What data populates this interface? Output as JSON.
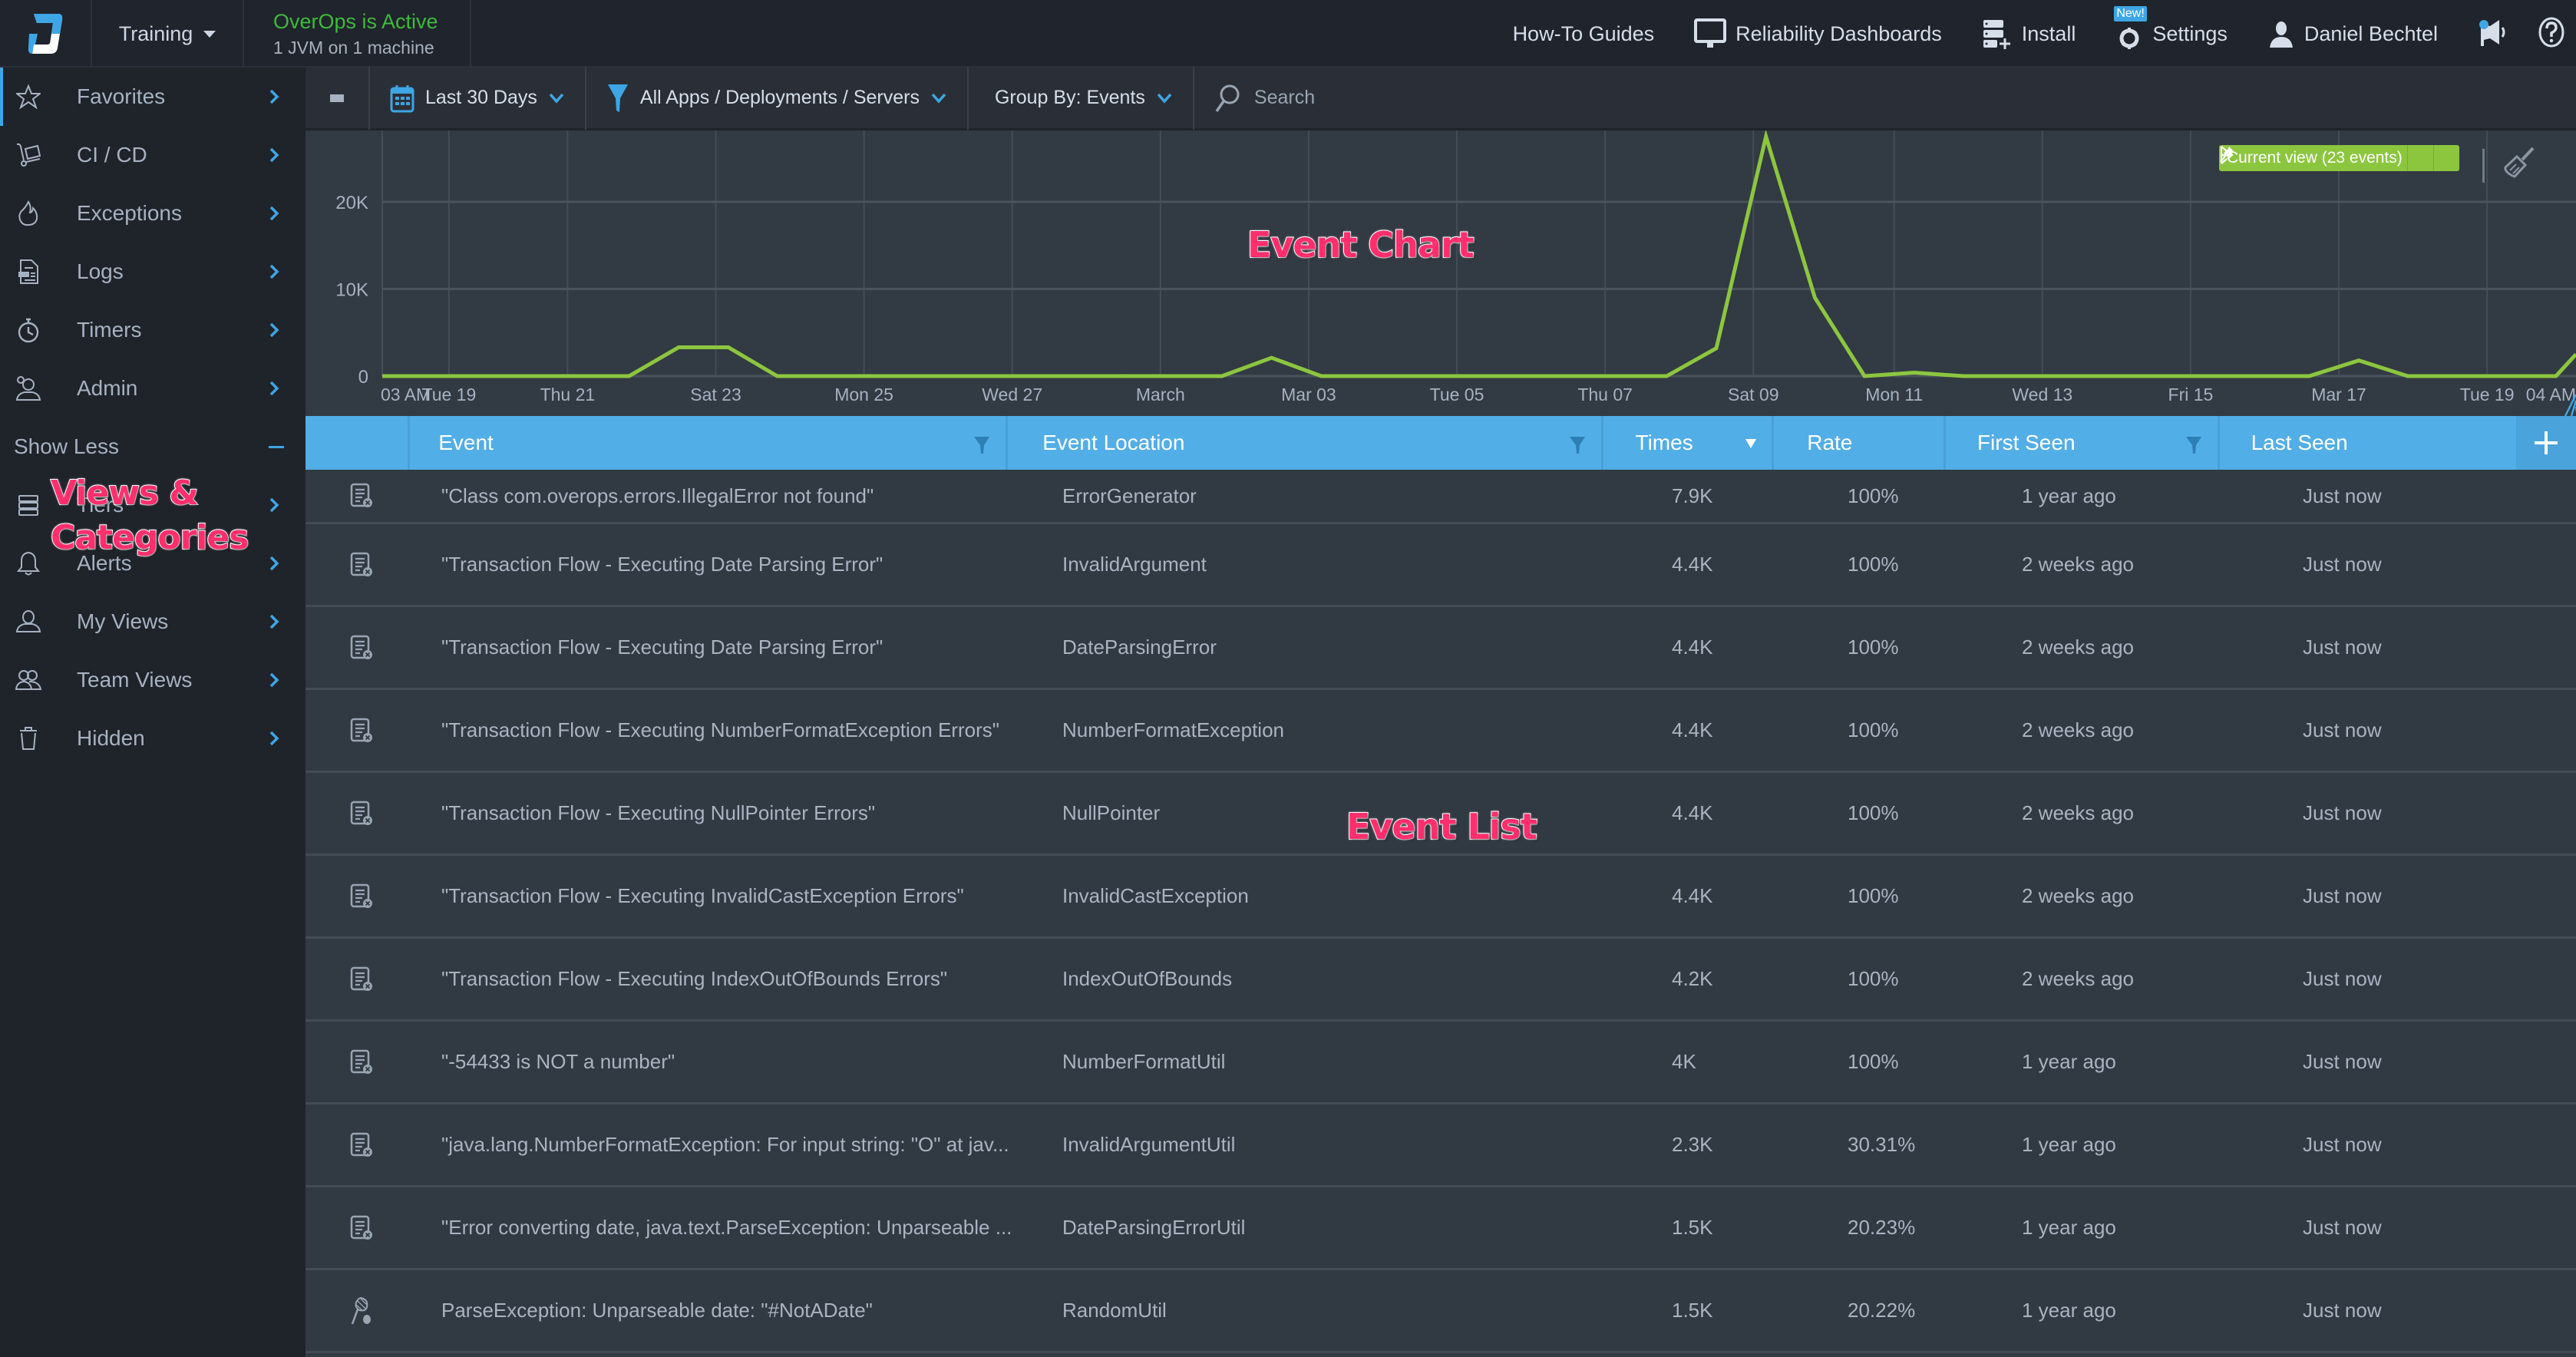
{
  "topbar": {
    "logo_icon": "overops-logo",
    "environment": "Training",
    "status_title": "OverOps is Active",
    "status_subtitle": "1 JVM on 1 machine",
    "nav": [
      {
        "label": "How-To Guides",
        "icon": null
      },
      {
        "label": "Reliability Dashboards",
        "icon": "monitor-icon"
      },
      {
        "label": "Install",
        "icon": "server-plus-icon"
      },
      {
        "label": "Settings",
        "icon": "gear-icon",
        "badge": "New!"
      },
      {
        "label": "Daniel Bechtel",
        "icon": "user-icon"
      }
    ],
    "announce_icon": "megaphone-icon",
    "help_icon": "help-icon"
  },
  "sidebar": {
    "items": [
      {
        "label": "Favorites",
        "icon": "star-icon",
        "active": true
      },
      {
        "label": "CI / CD",
        "icon": "dolly-icon"
      },
      {
        "label": "Exceptions",
        "icon": "flame-icon"
      },
      {
        "label": "Logs",
        "icon": "log-file-icon"
      },
      {
        "label": "Timers",
        "icon": "stopwatch-icon"
      },
      {
        "label": "Admin",
        "icon": "admin-user-icon"
      }
    ],
    "show_less": "Show Less",
    "more_items": [
      {
        "label": "Tiers",
        "icon": "tiers-icon"
      },
      {
        "label": "Alerts",
        "icon": "bell-icon"
      },
      {
        "label": "My Views",
        "icon": "user-icon"
      },
      {
        "label": "Team Views",
        "icon": "team-icon"
      },
      {
        "label": "Hidden",
        "icon": "trash-icon"
      }
    ]
  },
  "filterbar": {
    "time_range": "Last 30 Days",
    "scope": "All Apps / Deployments / Servers",
    "group_by": "Group By: Events",
    "search_placeholder": "Search"
  },
  "chart": {
    "current_view_label": "Current view (23 events)"
  },
  "annotations": {
    "views": "Views &",
    "categories": "Categories",
    "event_chart": "Event Chart",
    "event_list": "Event List"
  },
  "chart_data": {
    "type": "line",
    "title": "",
    "xlabel": "",
    "ylabel": "",
    "ylim": [
      0,
      28000
    ],
    "yticks": [
      0,
      10000,
      20000
    ],
    "ytick_labels": [
      "0",
      "10K",
      "20K"
    ],
    "xtick_labels": [
      "03 AM",
      "Tue 19",
      "Thu 21",
      "Sat 23",
      "Mon 25",
      "Wed 27",
      "March",
      "Mar 03",
      "Tue 05",
      "Thu 07",
      "Sat 09",
      "Mon 11",
      "Wed 13",
      "Fri 15",
      "Mar 17",
      "Tue 19",
      "04 AM"
    ],
    "xtick_days": [
      -0.3,
      0.6,
      2.2,
      4.2,
      6.2,
      8.2,
      10.2,
      12.2,
      14.2,
      16.2,
      18.2,
      20.1,
      22.1,
      24.1,
      26.1,
      28.1,
      28.9
    ],
    "x_range_days": [
      -0.3,
      29.3
    ],
    "grid": true,
    "legend": "none",
    "series": [
      {
        "name": "Events",
        "color": "#8cc63f",
        "x_days": [
          -0.3,
          0.37,
          1.03,
          1.7,
          2.37,
          3.03,
          3.7,
          4.37,
          5.03,
          5.7,
          6.37,
          7.03,
          7.7,
          8.37,
          9.03,
          9.7,
          10.37,
          11.03,
          11.7,
          12.37,
          13.03,
          13.7,
          14.37,
          15.03,
          15.7,
          16.37,
          17.03,
          17.7,
          18.37,
          19.03,
          19.7,
          20.37,
          21.03,
          21.7,
          22.37,
          23.03,
          23.7,
          24.37,
          25.03,
          25.7,
          26.37,
          27.03,
          27.7,
          28.37,
          29.03,
          29.3
        ],
        "values": [
          0,
          0,
          0,
          0,
          0,
          0,
          3300,
          3300,
          0,
          0,
          0,
          0,
          0,
          0,
          0,
          0,
          0,
          0,
          2100,
          0,
          0,
          0,
          0,
          0,
          0,
          0,
          0,
          3200,
          27500,
          9000,
          0,
          400,
          0,
          0,
          0,
          0,
          0,
          0,
          0,
          0,
          1800,
          0,
          0,
          0,
          0,
          2500
        ]
      }
    ]
  },
  "table": {
    "columns": [
      {
        "label": "",
        "key": "type"
      },
      {
        "label": "Event",
        "filter": true
      },
      {
        "label": "Event Location",
        "filter": true
      },
      {
        "label": "Times",
        "sort": "desc"
      },
      {
        "label": "Rate"
      },
      {
        "label": "First Seen",
        "filter": true
      },
      {
        "label": "Last Seen"
      }
    ],
    "add_column_icon": "plus-icon",
    "rows": [
      {
        "type": "logged-error-icon",
        "event": "\"Class com.overops.errors.IllegalError not found\"",
        "location": "ErrorGenerator",
        "times": "7.9K",
        "rate": "100%",
        "first_seen": "1 year ago",
        "last_seen": "Just now"
      },
      {
        "type": "logged-error-icon",
        "event": "\"Transaction Flow - Executing Date Parsing Error\"",
        "location": "InvalidArgument",
        "times": "4.4K",
        "rate": "100%",
        "first_seen": "2 weeks ago",
        "last_seen": "Just now"
      },
      {
        "type": "logged-error-icon",
        "event": "\"Transaction Flow - Executing Date Parsing Error\"",
        "location": "DateParsingError",
        "times": "4.4K",
        "rate": "100%",
        "first_seen": "2 weeks ago",
        "last_seen": "Just now"
      },
      {
        "type": "logged-error-icon",
        "event": "\"Transaction Flow - Executing NumberFormatException Errors\"",
        "location": "NumberFormatException",
        "times": "4.4K",
        "rate": "100%",
        "first_seen": "2 weeks ago",
        "last_seen": "Just now"
      },
      {
        "type": "logged-error-icon",
        "event": "\"Transaction Flow - Executing NullPointer Errors\"",
        "location": "NullPointer",
        "times": "4.4K",
        "rate": "100%",
        "first_seen": "2 weeks ago",
        "last_seen": "Just now"
      },
      {
        "type": "logged-error-icon",
        "event": "\"Transaction Flow - Executing InvalidCastException Errors\"",
        "location": "InvalidCastException",
        "times": "4.4K",
        "rate": "100%",
        "first_seen": "2 weeks ago",
        "last_seen": "Just now"
      },
      {
        "type": "logged-error-icon",
        "event": "\"Transaction Flow - Executing IndexOutOfBounds Errors\"",
        "location": "IndexOutOfBounds",
        "times": "4.2K",
        "rate": "100%",
        "first_seen": "2 weeks ago",
        "last_seen": "Just now"
      },
      {
        "type": "logged-error-icon",
        "event": "\"-54433 is NOT a number\"",
        "location": "NumberFormatUtil",
        "times": "4K",
        "rate": "100%",
        "first_seen": "1 year ago",
        "last_seen": "Just now"
      },
      {
        "type": "logged-error-icon",
        "event": "\"java.lang.NumberFormatException: For input string: \"O\" at jav...",
        "location": "InvalidArgumentUtil",
        "times": "2.3K",
        "rate": "30.31%",
        "first_seen": "1 year ago",
        "last_seen": "Just now"
      },
      {
        "type": "logged-error-icon",
        "event": "\"Error converting date, java.text.ParseException: Unparseable ...",
        "location": "DateParsingErrorUtil",
        "times": "1.5K",
        "rate": "20.23%",
        "first_seen": "1 year ago",
        "last_seen": "Just now"
      },
      {
        "type": "caught-exception-icon",
        "event": "ParseException: Unparseable date: \"#NotADate\"",
        "location": "RandomUtil",
        "times": "1.5K",
        "rate": "20.22%",
        "first_seen": "1 year ago",
        "last_seen": "Just now"
      }
    ]
  }
}
